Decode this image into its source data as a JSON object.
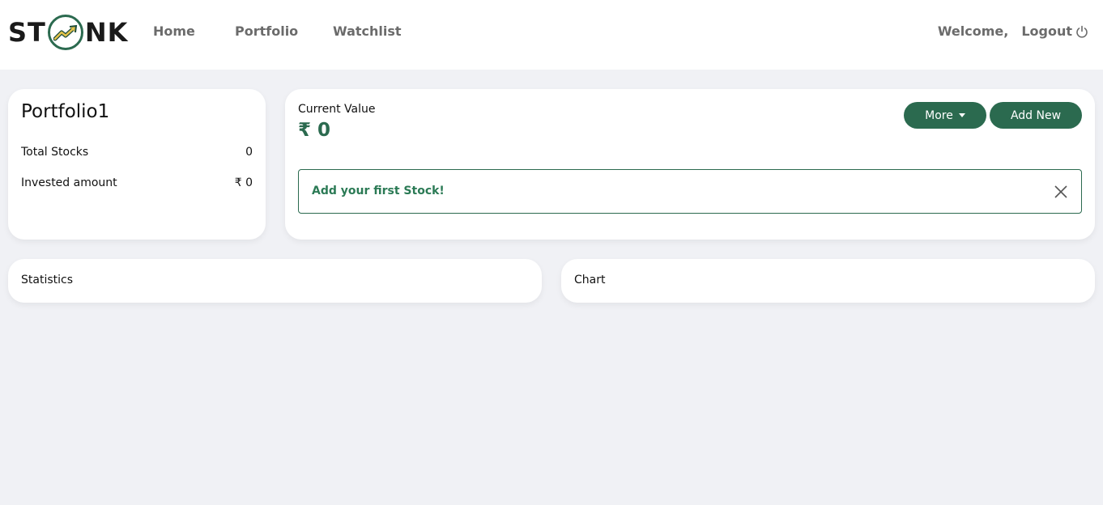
{
  "brand": {
    "name_left": "ST",
    "name_right": "NK",
    "logo_icon": "trend-up-arrow-icon"
  },
  "nav": {
    "links": [
      "Home",
      "Portfolio",
      "Watchlist"
    ],
    "welcome": "Welcome,",
    "logout": "Logout"
  },
  "portfolio": {
    "name": "Portfolio1",
    "total_stocks_label": "Total Stocks",
    "total_stocks_value": "0",
    "invested_label": "Invested amount",
    "invested_value": "₹ 0"
  },
  "current_value": {
    "label": "Current Value",
    "amount": "₹ 0",
    "more_button": "More",
    "add_button": "Add New",
    "alert_text": "Add your first Stock!"
  },
  "statistics": {
    "title": "Statistics"
  },
  "chart": {
    "title": "Chart"
  },
  "colors": {
    "accent": "#2b6a4f",
    "background": "#f0f1f5",
    "nav_text": "#6b6b6b"
  }
}
